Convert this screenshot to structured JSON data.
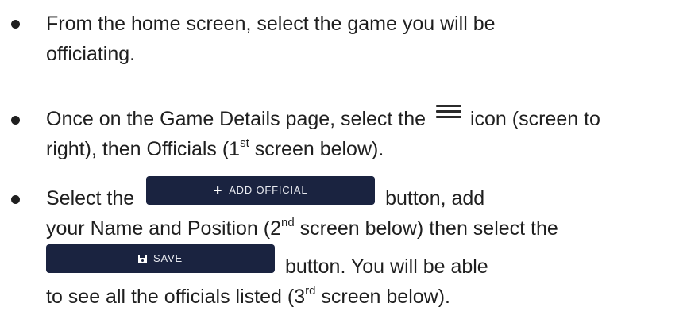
{
  "bullets": [
    {
      "line1": "From the home screen, select the game you will be",
      "line2": "officiating."
    },
    {
      "line1_a": "Once on the Game Details page, select the",
      "line1_b": "icon (screen to",
      "line2_a": "right), then Officials (1",
      "line2_sup": "st",
      "line2_b": " screen below)."
    },
    {
      "line1_a": "Select the",
      "add_official_button": "ADD OFFICIAL",
      "line1_b": "button, add",
      "line2_a": "your Name and Position (2",
      "line2_sup": "nd",
      "line2_b": " screen below) then select the",
      "save_button": "SAVE",
      "line3_b": "button. You will be able",
      "line4_a": "to see all the officials listed (3",
      "line4_sup": "rd",
      "line4_b": " screen below)."
    }
  ],
  "icons": {
    "menu": "hamburger-menu-icon",
    "add": "plus-icon",
    "save": "floppy-disk-icon"
  },
  "colors": {
    "text": "#1f1f1f",
    "button_bg": "#1a2340",
    "button_text": "#e8eaf0"
  }
}
